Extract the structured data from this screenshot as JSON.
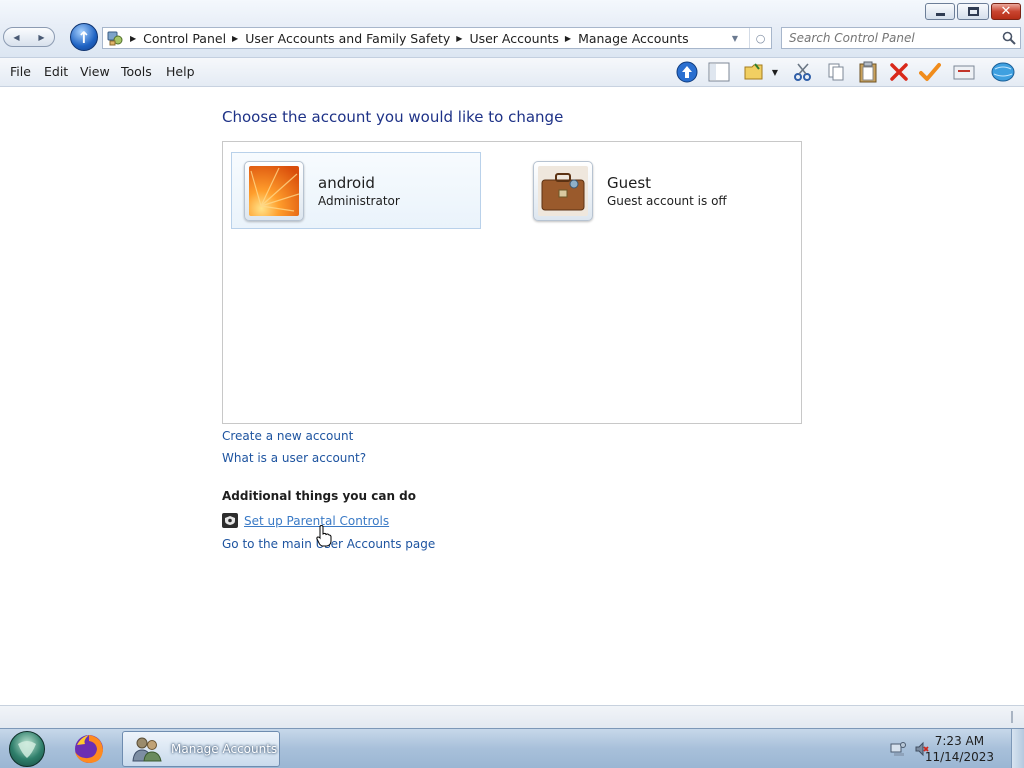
{
  "window": {
    "buttons": {
      "minimize": "—",
      "maximize": "□",
      "close": "✕"
    }
  },
  "address": {
    "crumbs": [
      "Control Panel",
      "User Accounts and Family Safety",
      "User Accounts",
      "Manage Accounts"
    ]
  },
  "search": {
    "placeholder": "Search Control Panel"
  },
  "menu": {
    "items": [
      "File",
      "Edit",
      "View",
      "Tools",
      "Help"
    ]
  },
  "toolbar": {
    "icons": [
      "up-arrow-icon",
      "panel-toggle-icon",
      "folder-icon",
      "dropdown-arrow-icon",
      "cut-icon",
      "copy-icon",
      "paste-icon",
      "delete-icon",
      "check-icon",
      "properties-icon",
      "globe-icon"
    ]
  },
  "main": {
    "heading": "Choose the account you would like to change",
    "accounts": [
      {
        "name": "android",
        "role": "Administrator",
        "picture": "orange-flower"
      },
      {
        "name": "Guest",
        "role": "Guest account is off",
        "picture": "briefcase"
      }
    ],
    "links": {
      "create": "Create a new account",
      "what_is": "What is a user account?",
      "parental": "Set up Parental Controls",
      "main_page": "Go to the main User Accounts page"
    },
    "additional_heading": "Additional things you can do"
  },
  "taskbar": {
    "task_label": "Manage Accounts",
    "time": "7:23 AM",
    "date": "11/14/2023"
  },
  "colors": {
    "link": "#1e54a0",
    "heading": "#1e3287",
    "selected_tile": "#eaf3fb"
  }
}
